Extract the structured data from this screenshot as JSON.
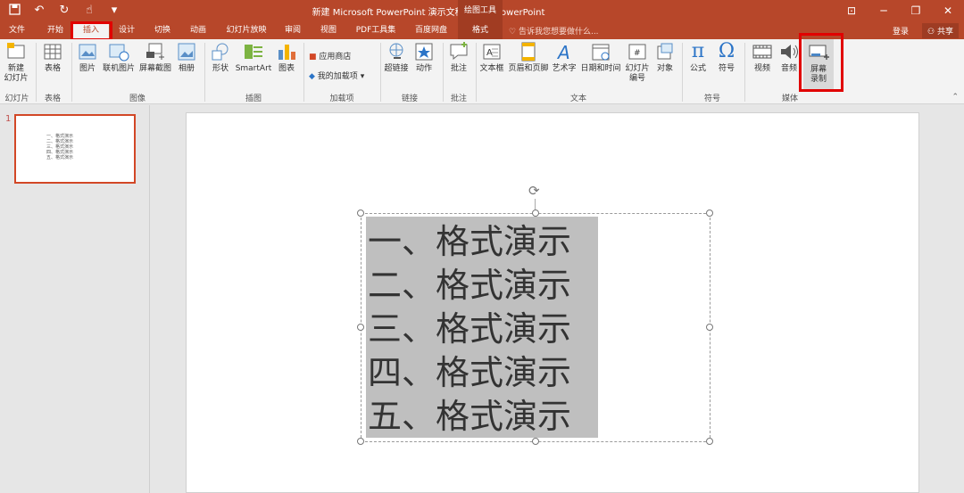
{
  "titlebar": {
    "title": "新建 Microsoft PowerPoint 演示文稿.pptx - PowerPoint",
    "context_group": "绘图工具",
    "qat": [
      "save-icon",
      "undo-icon",
      "redo-icon",
      "touch-icon",
      "customize-icon"
    ]
  },
  "tabs": {
    "file": "文件",
    "home": "开始",
    "insert": "插入",
    "design": "设计",
    "transitions": "切换",
    "animations": "动画",
    "slideshow": "幻灯片放映",
    "review": "审阅",
    "view": "视图",
    "pdf": "PDF工具集",
    "baidu": "百度网盘",
    "format": "格式",
    "tell_me": "告诉我您想要做什么...",
    "login": "登录",
    "share": "共享"
  },
  "ribbon": {
    "new_slide": "新建\n幻灯片",
    "table": "表格",
    "picture": "图片",
    "online_picture": "联机图片",
    "screenshot": "屏幕截图",
    "album": "相册",
    "shapes": "形状",
    "smartart": "SmartArt",
    "chart": "图表",
    "store": "应用商店",
    "my_addins": "我的加载项",
    "hyperlink": "超链接",
    "action": "动作",
    "comment": "批注",
    "textbox": "文本框",
    "header_footer": "页眉和页脚",
    "wordart": "艺术字",
    "datetime": "日期和时间",
    "slide_number": "幻灯片\n编号",
    "object": "对象",
    "equation": "公式",
    "symbol": "符号",
    "video": "视频",
    "audio": "音频",
    "screen_record": "屏幕\n录制",
    "groups": {
      "slides": "幻灯片",
      "tables": "表格",
      "images": "图像",
      "illustrations": "插图",
      "addins": "加载项",
      "links": "链接",
      "comments": "批注",
      "text": "文本",
      "symbols": "符号",
      "media": "媒体"
    }
  },
  "slide_panel": {
    "number": "1"
  },
  "slide": {
    "lines": [
      "一、格式演示",
      "二、格式演示",
      "三、格式演示",
      "四、格式演示",
      "五、格式演示"
    ]
  }
}
